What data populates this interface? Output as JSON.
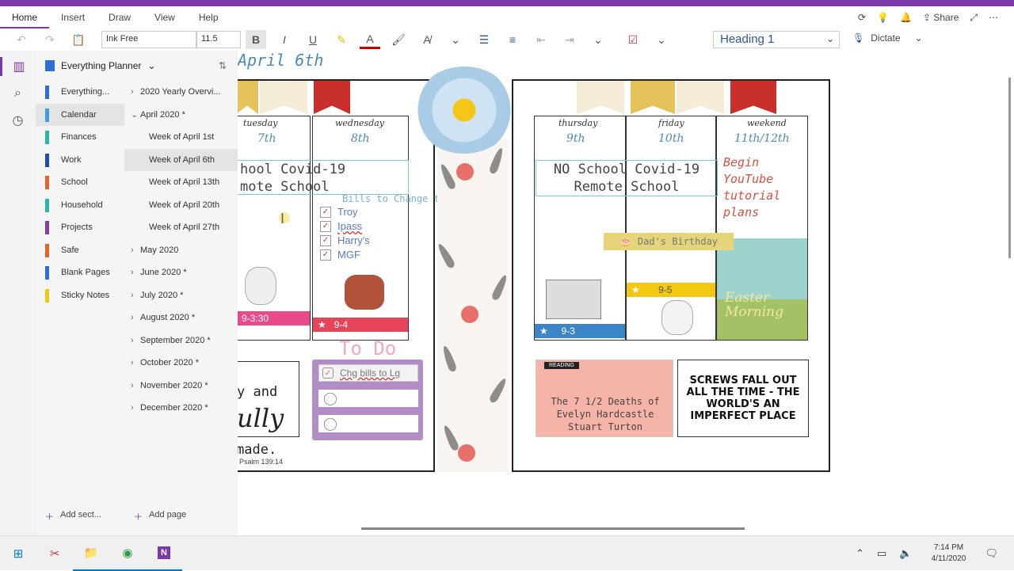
{
  "tabs": [
    "Home",
    "Insert",
    "Draw",
    "View",
    "Help"
  ],
  "share_label": "Share",
  "ribbon": {
    "font_name": "Ink Free",
    "font_size": "11.5",
    "bold": "B",
    "italic": "I",
    "underline": "U",
    "style": "Heading 1",
    "dictate": "Dictate"
  },
  "notebook": {
    "title": "Everything Planner"
  },
  "sections": [
    {
      "label": "Everything...",
      "color": "#2b6fd6"
    },
    {
      "label": "Calendar",
      "color": "#3aa0e8"
    },
    {
      "label": "Finances",
      "color": "#2bb3a6"
    },
    {
      "label": "Work",
      "color": "#1f4fae"
    },
    {
      "label": "School",
      "color": "#e8622c"
    },
    {
      "label": "Household",
      "color": "#2ab7a9"
    },
    {
      "label": "Projects",
      "color": "#8c3aa8"
    },
    {
      "label": "Safe",
      "color": "#e8622c"
    },
    {
      "label": "Blank Pages",
      "color": "#2b6fd6"
    },
    {
      "label": "Sticky Notes",
      "color": "#f2c811"
    }
  ],
  "pages": [
    {
      "label": "2020 Yearly Overvi...",
      "indent": 1,
      "arrow": ">"
    },
    {
      "label": "April 2020 *",
      "indent": 1,
      "arrow": "v"
    },
    {
      "label": "Week of April 1st",
      "indent": 2,
      "arrow": ""
    },
    {
      "label": "Week of April 6th",
      "indent": 2,
      "arrow": ""
    },
    {
      "label": "Week of April 13th",
      "indent": 2,
      "arrow": ""
    },
    {
      "label": "Week of April 20th",
      "indent": 2,
      "arrow": ""
    },
    {
      "label": "Week of April 27th",
      "indent": 2,
      "arrow": ""
    },
    {
      "label": "May 2020",
      "indent": 1,
      "arrow": ">"
    },
    {
      "label": "June 2020 *",
      "indent": 1,
      "arrow": ">"
    },
    {
      "label": "July 2020 *",
      "indent": 1,
      "arrow": ">"
    },
    {
      "label": "August 2020 *",
      "indent": 1,
      "arrow": ">"
    },
    {
      "label": "September 2020 *",
      "indent": 1,
      "arrow": ">"
    },
    {
      "label": "October 2020 *",
      "indent": 1,
      "arrow": ">"
    },
    {
      "label": "November 2020 *",
      "indent": 1,
      "arrow": ">"
    },
    {
      "label": "December 2020 *",
      "indent": 1,
      "arrow": ">"
    }
  ],
  "add_section": "Add sect...",
  "add_page": "Add page",
  "page": {
    "title": "April 6th",
    "days_left": [
      {
        "name": "tuesday",
        "num": "7th"
      },
      {
        "name": "wednesday",
        "num": "8th"
      }
    ],
    "days_right": [
      {
        "name": "thursday",
        "num": "9th"
      },
      {
        "name": "friday",
        "num": "10th"
      },
      {
        "name": "weekend",
        "num": "11th/12th"
      }
    ],
    "covid_left_1": "hool Covid-19",
    "covid_left_2": "mote School",
    "covid_right_1": "NO School Covid-19",
    "covid_right_2": "Remote School",
    "bills_heading": "Bills to Change to Lg",
    "bills": [
      "Troy",
      "Ipass",
      "Harry's",
      "MGF"
    ],
    "banner_7": "9-3:30",
    "banner_8": "9-4",
    "banner_9": "9-3",
    "banner_10": "9-5",
    "birthday": "Dad's Birthday",
    "weekend_note": "Begin YouTube tutorial plans",
    "easter": "Easter Morning",
    "todo_title": "To Do",
    "todo_item": "Chg bills to Lg",
    "verse_1": "y and",
    "verse_2": "ully",
    "verse_3": "made.",
    "verse_ref": "Psalm 139:14",
    "reading_tag": "READING",
    "book": "The 7 1/2 Deaths of Evelyn Hardcastle Stuart Turton",
    "quote": "SCREWS FALL OUT ALL THE TIME - THE WORLD'S AN IMPERFECT PLACE"
  },
  "taskbar": {
    "time": "7:14 PM",
    "date": "4/11/2020"
  }
}
